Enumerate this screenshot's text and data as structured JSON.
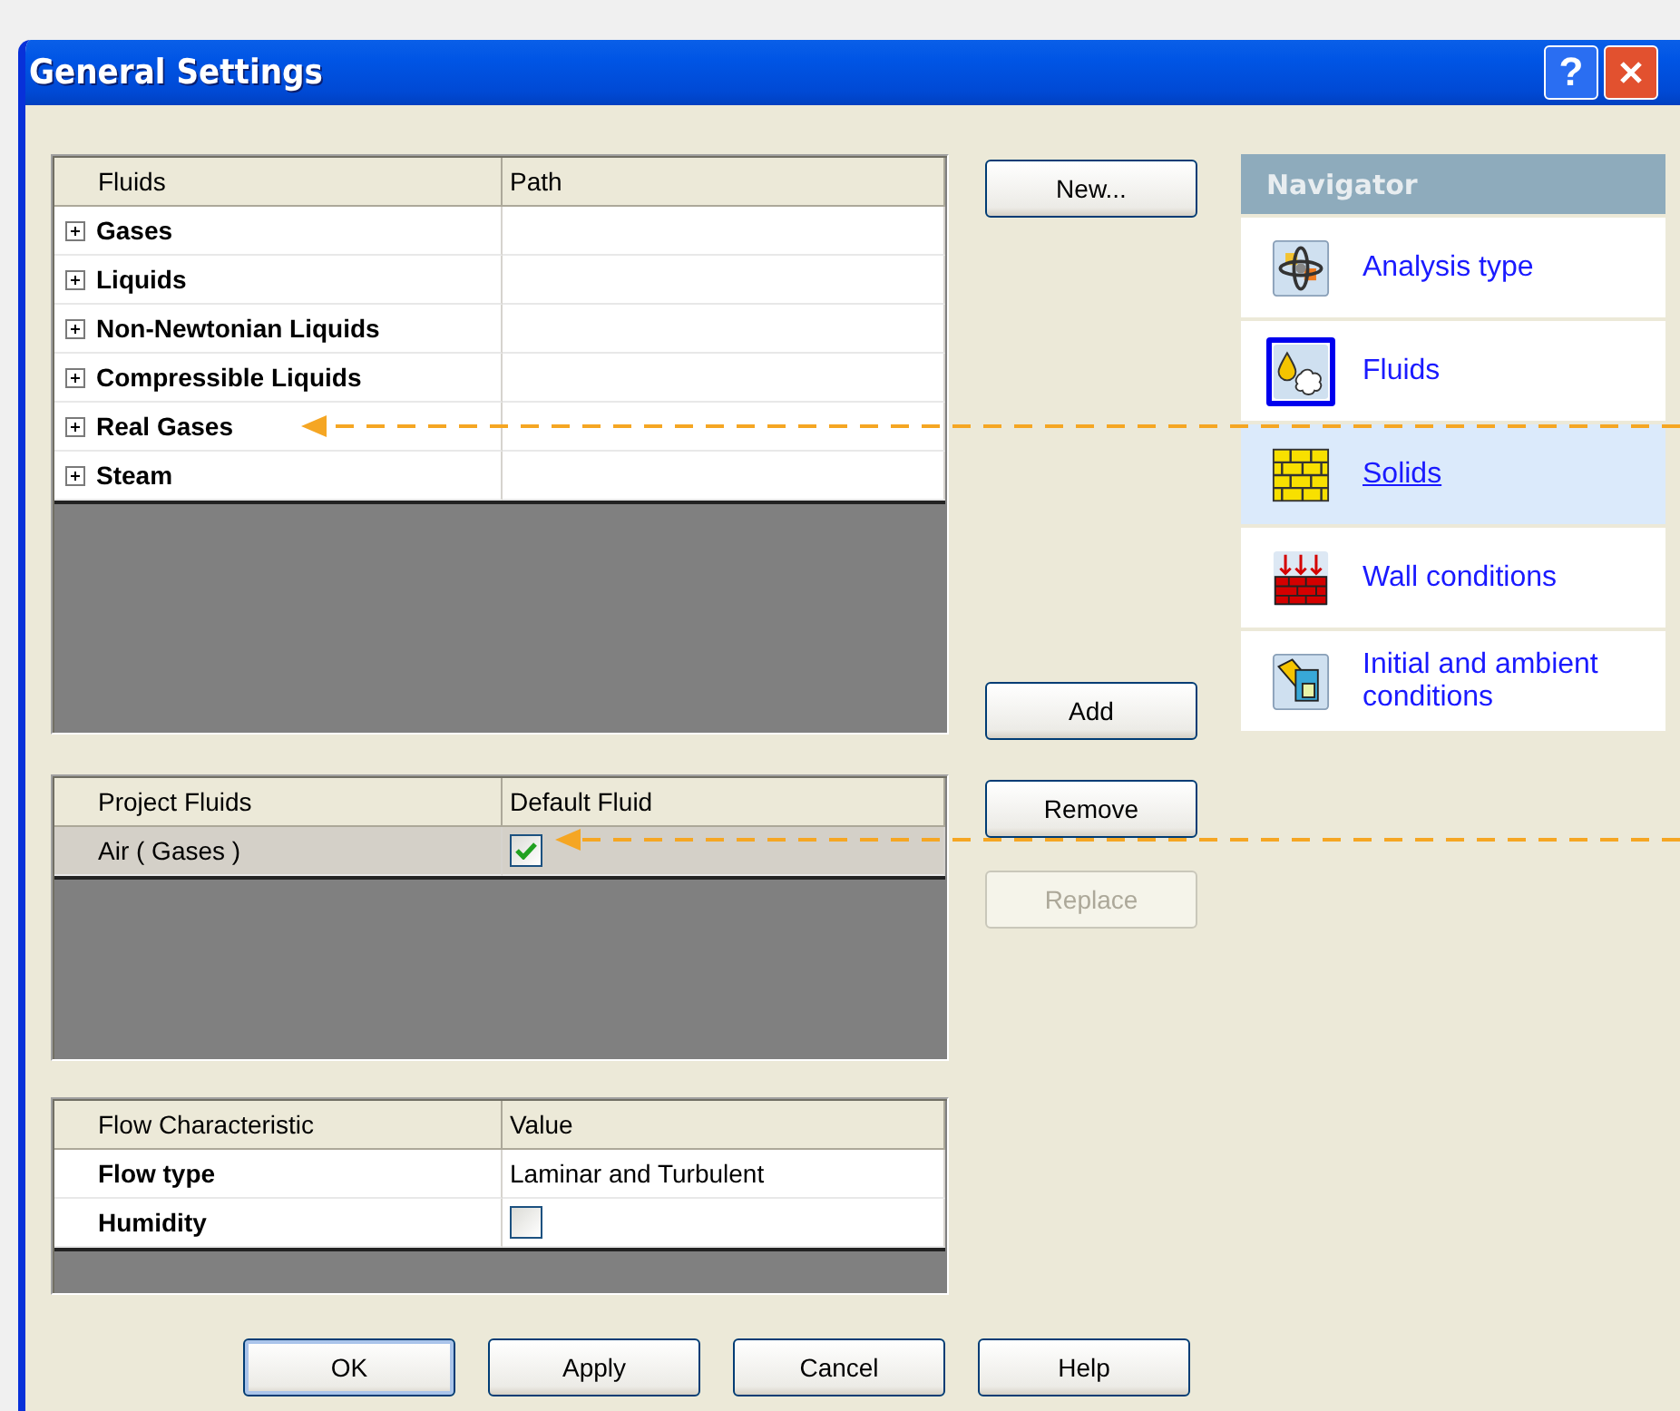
{
  "window": {
    "title": "General Settings",
    "help": "?"
  },
  "fluids_table": {
    "columns": [
      "Fluids",
      "Path"
    ],
    "rows": [
      {
        "name": "Gases",
        "expanded": false
      },
      {
        "name": "Liquids",
        "expanded": false
      },
      {
        "name": "Non-Newtonian Liquids",
        "expanded": false
      },
      {
        "name": "Compressible Liquids",
        "expanded": false
      },
      {
        "name": "Real Gases",
        "expanded": false
      },
      {
        "name": "Steam",
        "expanded": false
      }
    ]
  },
  "project_fluids": {
    "columns": [
      "Project Fluids",
      "Default Fluid"
    ],
    "rows": [
      {
        "name": "Air ( Gases )",
        "default": true,
        "selected": true
      }
    ]
  },
  "flow_table": {
    "columns": [
      "Flow Characteristic",
      "Value"
    ],
    "rows": [
      {
        "name": "Flow type",
        "kind": "text",
        "value": "Laminar and Turbulent"
      },
      {
        "name": "Humidity",
        "kind": "checkbox",
        "checked": false
      }
    ]
  },
  "side_buttons": [
    {
      "label": "New...",
      "disabled": false
    },
    {
      "label": "Add",
      "disabled": false
    },
    {
      "label": "Remove",
      "disabled": false
    },
    {
      "label": "Replace",
      "disabled": true
    }
  ],
  "navigator": {
    "title": "Navigator",
    "items": [
      {
        "label": "Analysis type",
        "kind": "analysis",
        "current": false,
        "selected": false
      },
      {
        "label": "Fluids",
        "kind": "fluids",
        "current": true,
        "selected": false
      },
      {
        "label": "Solids",
        "kind": "solids",
        "current": false,
        "selected": true
      },
      {
        "label": "Wall conditions",
        "kind": "wall",
        "current": false,
        "selected": false
      },
      {
        "label": "Initial and ambient conditions",
        "kind": "initial",
        "current": false,
        "selected": false
      }
    ]
  },
  "buttons": [
    {
      "label": "OK",
      "default": true
    },
    {
      "label": "Apply",
      "default": false
    },
    {
      "label": "Cancel",
      "default": false
    },
    {
      "label": "Help",
      "default": false
    }
  ]
}
